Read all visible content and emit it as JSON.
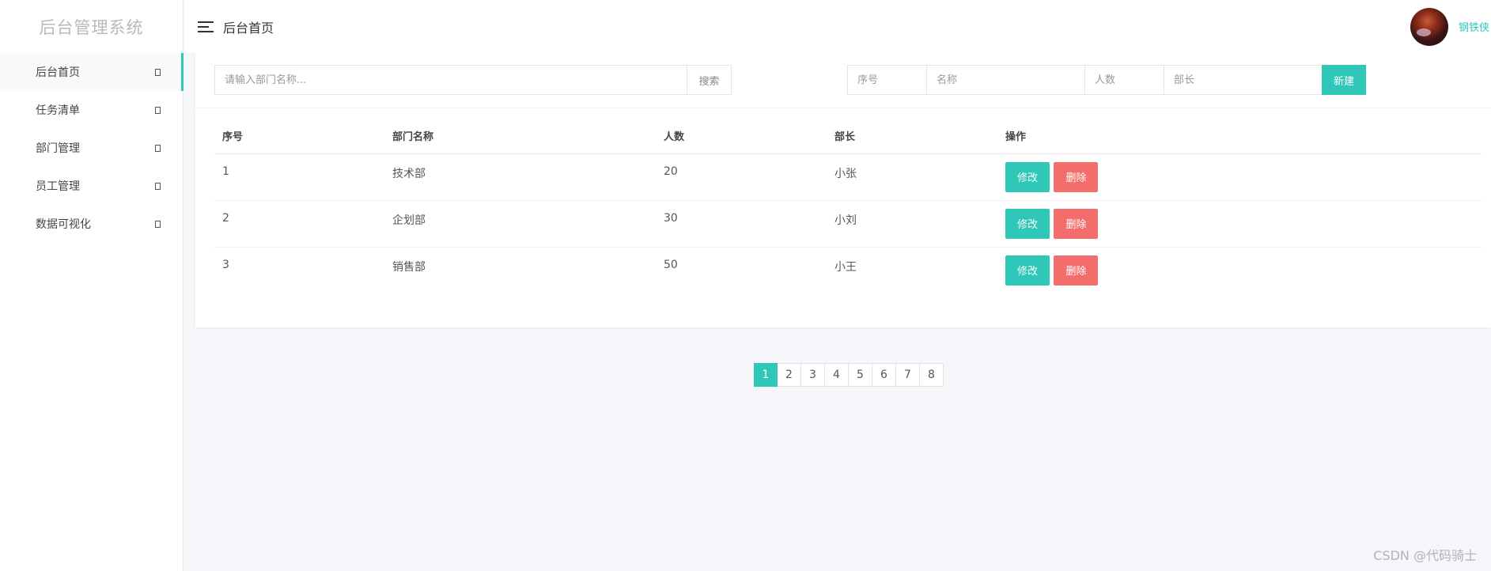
{
  "sidebar": {
    "brand": "后台管理系统",
    "items": [
      {
        "label": "后台首页",
        "active": true
      },
      {
        "label": "任务清单",
        "active": false
      },
      {
        "label": "部门管理",
        "active": false
      },
      {
        "label": "员工管理",
        "active": false
      },
      {
        "label": "数据可视化",
        "active": false
      }
    ]
  },
  "header": {
    "title": "后台首页",
    "username": "钢铁侠"
  },
  "search": {
    "placeholder": "请输入部门名称...",
    "button": "搜索"
  },
  "add_form": {
    "no_placeholder": "序号",
    "name_placeholder": "名称",
    "count_placeholder": "人数",
    "head_placeholder": "部长",
    "button": "新建"
  },
  "table": {
    "columns": [
      "序号",
      "部门名称",
      "人数",
      "部长",
      "操作"
    ],
    "rows": [
      {
        "no": "1",
        "name": "技术部",
        "count": "20",
        "head": "小张"
      },
      {
        "no": "2",
        "name": "企划部",
        "count": "30",
        "head": "小刘"
      },
      {
        "no": "3",
        "name": "销售部",
        "count": "50",
        "head": "小王"
      }
    ],
    "edit_label": "修改",
    "delete_label": "删除"
  },
  "pagination": {
    "pages": [
      "1",
      "2",
      "3",
      "4",
      "5",
      "6",
      "7",
      "8"
    ],
    "current": "1"
  },
  "watermark": "CSDN @代码骑士",
  "colors": {
    "accent": "#2ec7b8",
    "danger": "#f46d6d",
    "background": "#f4f6f9"
  }
}
